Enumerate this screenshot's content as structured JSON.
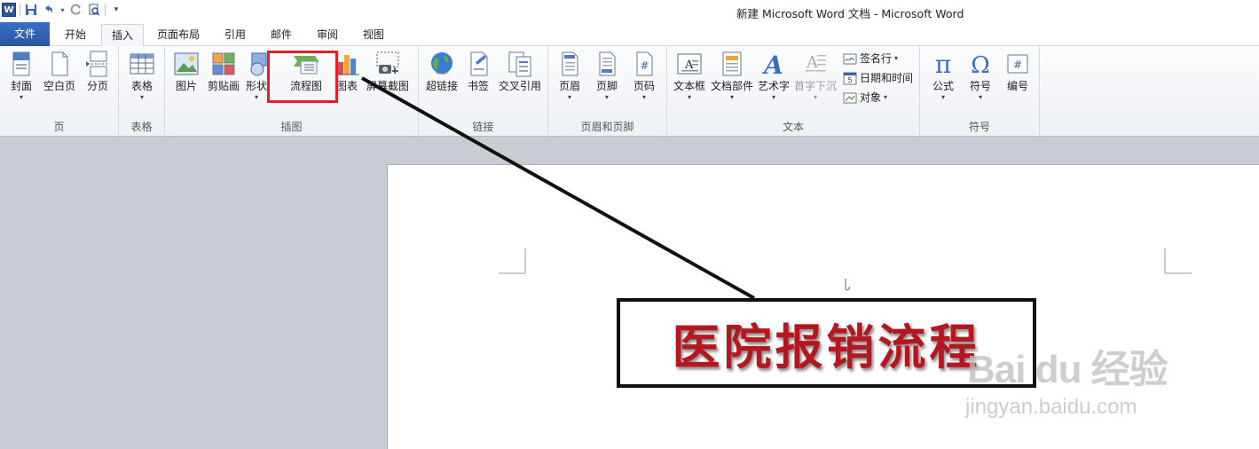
{
  "window": {
    "title": "新建 Microsoft Word 文档  -  Microsoft Word"
  },
  "qat": {
    "logo_letter": "W"
  },
  "tabs": [
    {
      "label": "文件"
    },
    {
      "label": "开始"
    },
    {
      "label": "插入"
    },
    {
      "label": "页面布局"
    },
    {
      "label": "引用"
    },
    {
      "label": "邮件"
    },
    {
      "label": "审阅"
    },
    {
      "label": "视图"
    }
  ],
  "groups": {
    "page": {
      "label": "页",
      "buttons": [
        "封面",
        "空白页",
        "分页"
      ]
    },
    "table": {
      "label": "表格",
      "buttons": [
        "表格"
      ]
    },
    "illustrations": {
      "label": "插图",
      "buttons": [
        "图片",
        "剪贴画",
        "形状",
        "流程图",
        "图表",
        "屏幕截图"
      ]
    },
    "links": {
      "label": "链接",
      "buttons": [
        "超链接",
        "书签",
        "交叉引用"
      ]
    },
    "header_footer": {
      "label": "页眉和页脚",
      "buttons": [
        "页眉",
        "页脚",
        "页码"
      ]
    },
    "text": {
      "label": "文本",
      "buttons": [
        "文本框",
        "文档部件",
        "艺术字",
        "首字下沉"
      ],
      "small": [
        "签名行",
        "日期和时间",
        "对象"
      ]
    },
    "symbols": {
      "label": "符号",
      "buttons": [
        "公式",
        "符号",
        "编号"
      ]
    }
  },
  "document": {
    "callout_text": "医院报销流程"
  },
  "watermark": {
    "brand": "Bai du 经验",
    "url": "jingyan.baidu.com"
  },
  "colors": {
    "accent": "#2a56a2",
    "highlight": "#e0202a",
    "callout_text": "#b31820"
  }
}
